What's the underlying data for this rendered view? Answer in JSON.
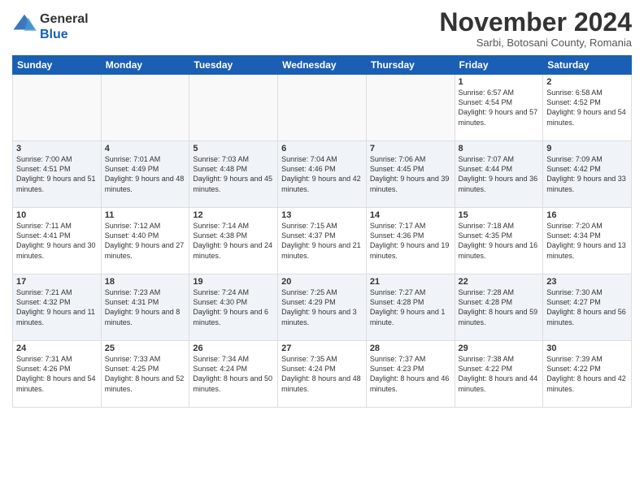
{
  "header": {
    "logo_line1": "General",
    "logo_line2": "Blue",
    "month": "November 2024",
    "location": "Sarbi, Botosani County, Romania"
  },
  "days_of_week": [
    "Sunday",
    "Monday",
    "Tuesday",
    "Wednesday",
    "Thursday",
    "Friday",
    "Saturday"
  ],
  "weeks": [
    [
      {
        "num": "",
        "info": ""
      },
      {
        "num": "",
        "info": ""
      },
      {
        "num": "",
        "info": ""
      },
      {
        "num": "",
        "info": ""
      },
      {
        "num": "",
        "info": ""
      },
      {
        "num": "1",
        "info": "Sunrise: 6:57 AM\nSunset: 4:54 PM\nDaylight: 9 hours and 57 minutes."
      },
      {
        "num": "2",
        "info": "Sunrise: 6:58 AM\nSunset: 4:52 PM\nDaylight: 9 hours and 54 minutes."
      }
    ],
    [
      {
        "num": "3",
        "info": "Sunrise: 7:00 AM\nSunset: 4:51 PM\nDaylight: 9 hours and 51 minutes."
      },
      {
        "num": "4",
        "info": "Sunrise: 7:01 AM\nSunset: 4:49 PM\nDaylight: 9 hours and 48 minutes."
      },
      {
        "num": "5",
        "info": "Sunrise: 7:03 AM\nSunset: 4:48 PM\nDaylight: 9 hours and 45 minutes."
      },
      {
        "num": "6",
        "info": "Sunrise: 7:04 AM\nSunset: 4:46 PM\nDaylight: 9 hours and 42 minutes."
      },
      {
        "num": "7",
        "info": "Sunrise: 7:06 AM\nSunset: 4:45 PM\nDaylight: 9 hours and 39 minutes."
      },
      {
        "num": "8",
        "info": "Sunrise: 7:07 AM\nSunset: 4:44 PM\nDaylight: 9 hours and 36 minutes."
      },
      {
        "num": "9",
        "info": "Sunrise: 7:09 AM\nSunset: 4:42 PM\nDaylight: 9 hours and 33 minutes."
      }
    ],
    [
      {
        "num": "10",
        "info": "Sunrise: 7:11 AM\nSunset: 4:41 PM\nDaylight: 9 hours and 30 minutes."
      },
      {
        "num": "11",
        "info": "Sunrise: 7:12 AM\nSunset: 4:40 PM\nDaylight: 9 hours and 27 minutes."
      },
      {
        "num": "12",
        "info": "Sunrise: 7:14 AM\nSunset: 4:38 PM\nDaylight: 9 hours and 24 minutes."
      },
      {
        "num": "13",
        "info": "Sunrise: 7:15 AM\nSunset: 4:37 PM\nDaylight: 9 hours and 21 minutes."
      },
      {
        "num": "14",
        "info": "Sunrise: 7:17 AM\nSunset: 4:36 PM\nDaylight: 9 hours and 19 minutes."
      },
      {
        "num": "15",
        "info": "Sunrise: 7:18 AM\nSunset: 4:35 PM\nDaylight: 9 hours and 16 minutes."
      },
      {
        "num": "16",
        "info": "Sunrise: 7:20 AM\nSunset: 4:34 PM\nDaylight: 9 hours and 13 minutes."
      }
    ],
    [
      {
        "num": "17",
        "info": "Sunrise: 7:21 AM\nSunset: 4:32 PM\nDaylight: 9 hours and 11 minutes."
      },
      {
        "num": "18",
        "info": "Sunrise: 7:23 AM\nSunset: 4:31 PM\nDaylight: 9 hours and 8 minutes."
      },
      {
        "num": "19",
        "info": "Sunrise: 7:24 AM\nSunset: 4:30 PM\nDaylight: 9 hours and 6 minutes."
      },
      {
        "num": "20",
        "info": "Sunrise: 7:25 AM\nSunset: 4:29 PM\nDaylight: 9 hours and 3 minutes."
      },
      {
        "num": "21",
        "info": "Sunrise: 7:27 AM\nSunset: 4:28 PM\nDaylight: 9 hours and 1 minute."
      },
      {
        "num": "22",
        "info": "Sunrise: 7:28 AM\nSunset: 4:28 PM\nDaylight: 8 hours and 59 minutes."
      },
      {
        "num": "23",
        "info": "Sunrise: 7:30 AM\nSunset: 4:27 PM\nDaylight: 8 hours and 56 minutes."
      }
    ],
    [
      {
        "num": "24",
        "info": "Sunrise: 7:31 AM\nSunset: 4:26 PM\nDaylight: 8 hours and 54 minutes."
      },
      {
        "num": "25",
        "info": "Sunrise: 7:33 AM\nSunset: 4:25 PM\nDaylight: 8 hours and 52 minutes."
      },
      {
        "num": "26",
        "info": "Sunrise: 7:34 AM\nSunset: 4:24 PM\nDaylight: 8 hours and 50 minutes."
      },
      {
        "num": "27",
        "info": "Sunrise: 7:35 AM\nSunset: 4:24 PM\nDaylight: 8 hours and 48 minutes."
      },
      {
        "num": "28",
        "info": "Sunrise: 7:37 AM\nSunset: 4:23 PM\nDaylight: 8 hours and 46 minutes."
      },
      {
        "num": "29",
        "info": "Sunrise: 7:38 AM\nSunset: 4:22 PM\nDaylight: 8 hours and 44 minutes."
      },
      {
        "num": "30",
        "info": "Sunrise: 7:39 AM\nSunset: 4:22 PM\nDaylight: 8 hours and 42 minutes."
      }
    ]
  ]
}
